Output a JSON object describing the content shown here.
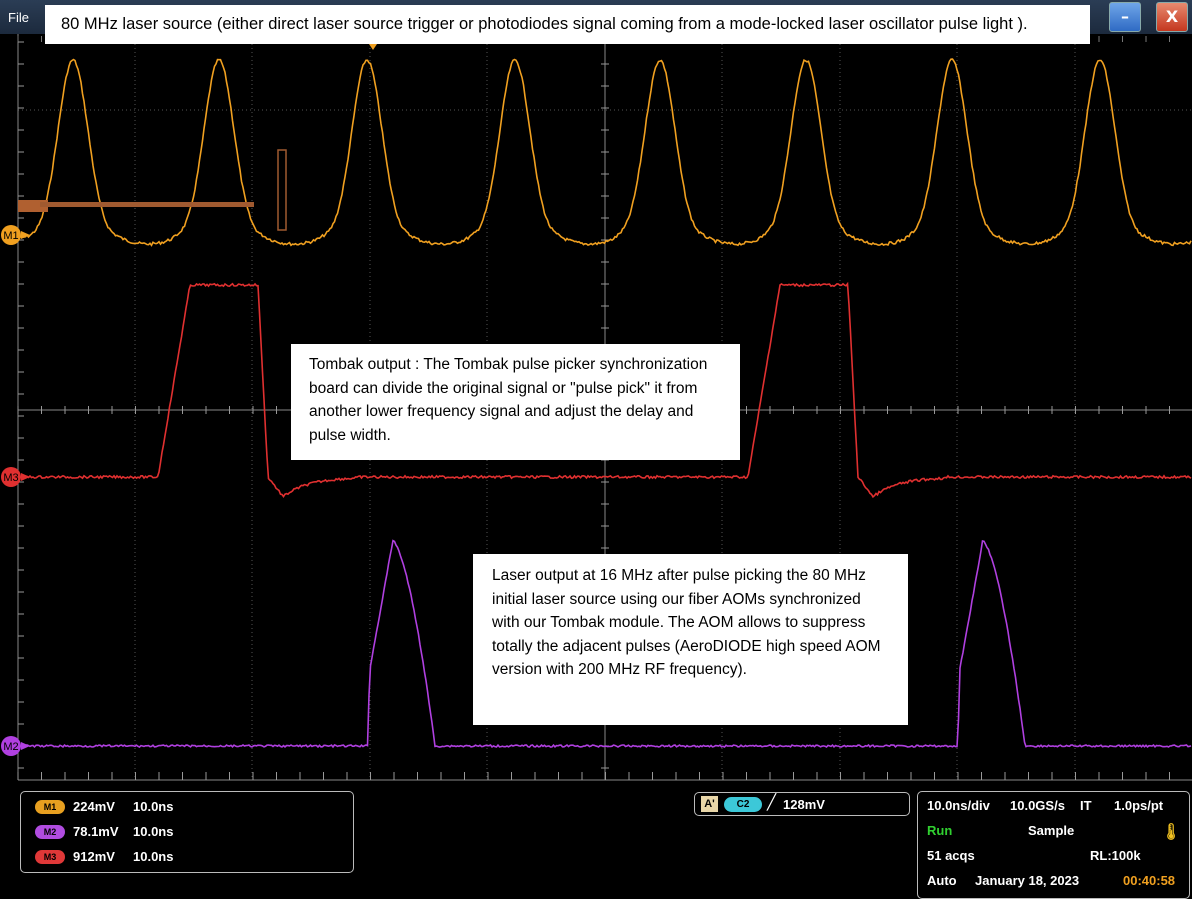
{
  "window": {
    "menu_file": "File",
    "minimize_glyph": "–",
    "close_glyph": "X"
  },
  "annotations": {
    "source": "80 MHz laser source (either direct laser source trigger or photodiodes signal coming from a mode-locked laser oscillator pulse light ).",
    "tombak": "Tombak output : The Tombak pulse picker synchronization board can divide the original signal or \"pulse pick\" it from another lower frequency signal and adjust the delay and pulse width.",
    "laser": "Laser output at 16 MHz after pulse picking the 80 MHz initial laser source using our fiber AOMs synchronized with our Tombak module. The AOM allows to suppress totally the adjacent pulses (AeroDIODE high speed AOM version with 200 MHz RF frequency)."
  },
  "waveforms": {
    "markers": [
      {
        "label": "M1",
        "color": "#f0a020"
      },
      {
        "label": "M3",
        "color": "#e03030"
      },
      {
        "label": "M2",
        "color": "#b040e0"
      }
    ]
  },
  "channels": [
    {
      "badge": "M1",
      "color": "#e8a020",
      "scale": "224mV",
      "timebase": "10.0ns"
    },
    {
      "badge": "M2",
      "color": "#b04ce0",
      "scale": "78.1mV",
      "timebase": "10.0ns"
    },
    {
      "badge": "M3",
      "color": "#e03838",
      "scale": "912mV",
      "timebase": "10.0ns"
    }
  ],
  "trigger": {
    "mode": "A'",
    "source": "C2",
    "slope_icon": "rising-edge-icon",
    "slope_glyph": "╱",
    "level": "128mV"
  },
  "acquisition": {
    "horizontal": "10.0ns/div",
    "sample_rate": "10.0GS/s",
    "mode_it": "IT",
    "resolution": "1.0ps/pt",
    "state": "Run",
    "state_color": "#30d030",
    "sample_mode": "Sample",
    "acqs": "51 acqs",
    "record_length": "RL:100k",
    "trigger_mode": "Auto",
    "date": "January 18, 2023",
    "time": "00:40:58",
    "time_color": "#f0a020"
  }
}
